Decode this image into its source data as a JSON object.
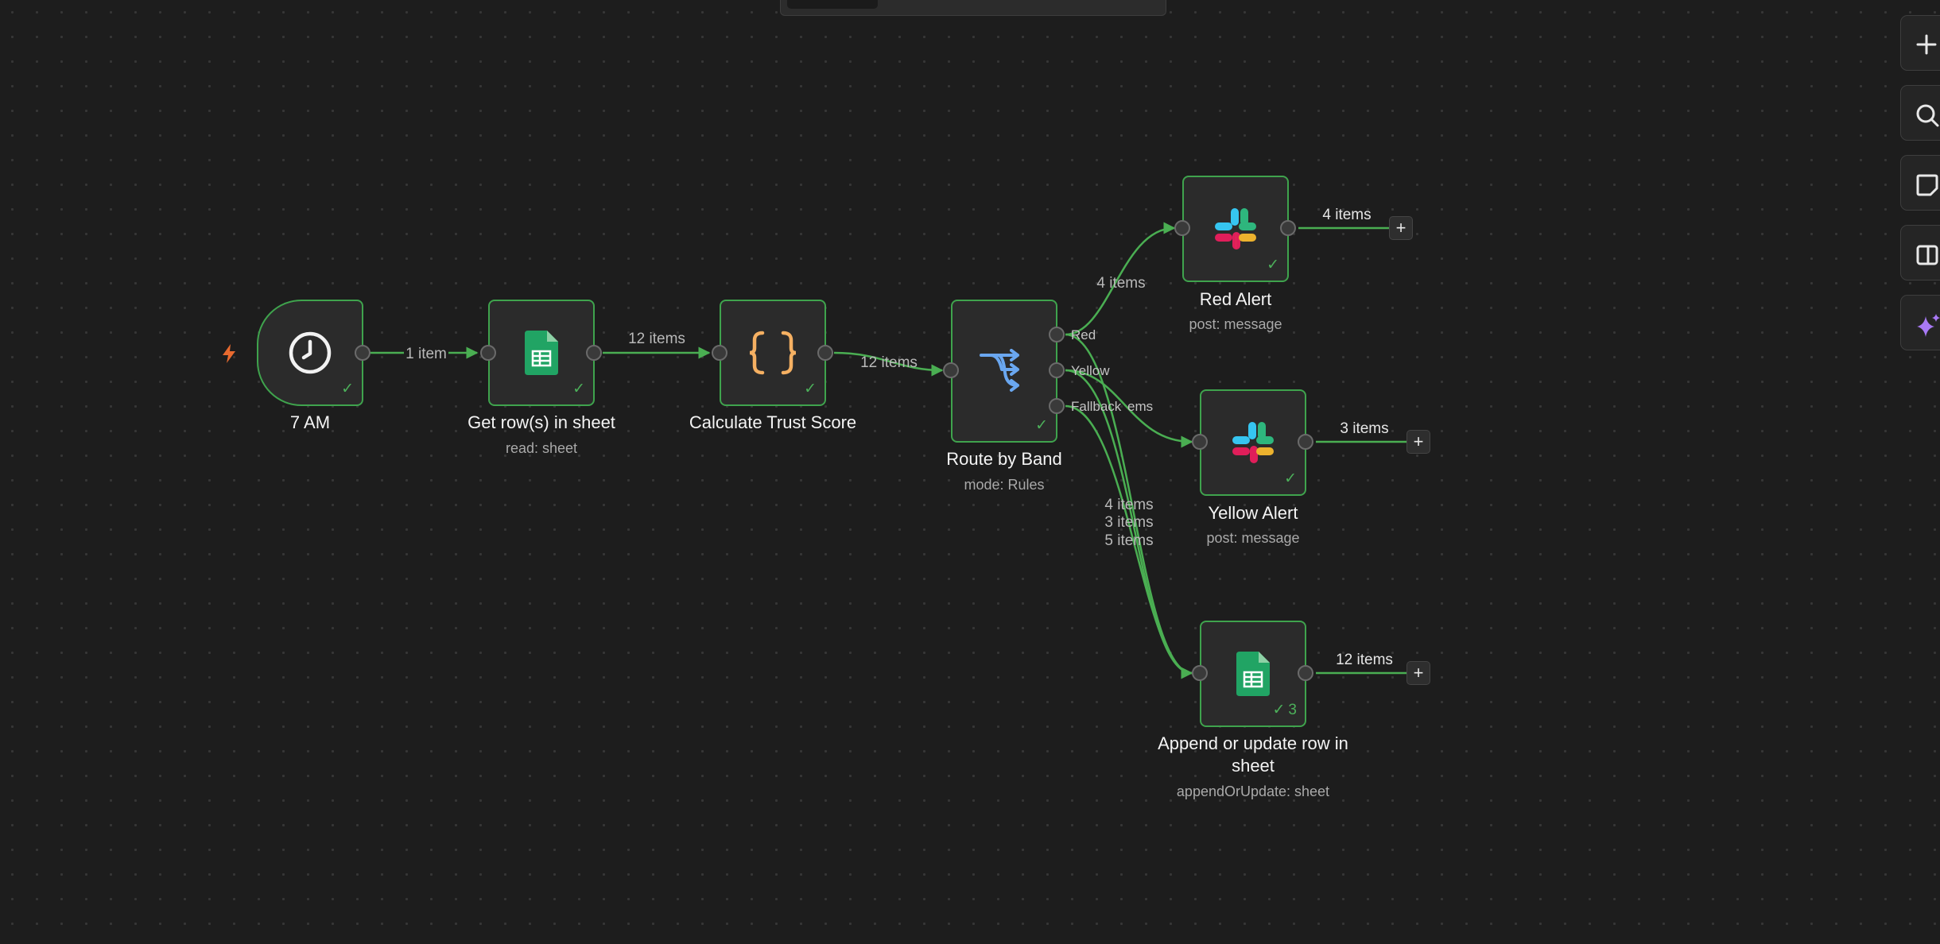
{
  "workflow": {
    "nodes": {
      "trigger": {
        "title": "7 AM",
        "icon": "clock-icon"
      },
      "get_rows": {
        "title": "Get row(s) in sheet",
        "subtitle": "read: sheet",
        "icon": "google-sheets-icon"
      },
      "calc": {
        "title": "Calculate Trust Score",
        "icon": "code-braces-icon"
      },
      "route": {
        "title": "Route by Band",
        "subtitle": "mode: Rules",
        "icon": "switch-route-icon"
      },
      "red_alert": {
        "title": "Red Alert",
        "subtitle": "post: message",
        "icon": "slack-icon"
      },
      "yellow_alert": {
        "title": "Yellow Alert",
        "subtitle": "post: message",
        "icon": "slack-icon"
      },
      "append": {
        "title_line1": "Append or update row in",
        "title_line2": "sheet",
        "subtitle": "appendOrUpdate: sheet",
        "icon": "google-sheets-icon",
        "run_count": "3"
      }
    },
    "edges": {
      "trigger_to_get": "1 item",
      "get_to_calc": "12 items",
      "calc_to_route": "12 items",
      "route_to_red": "4 items",
      "route_to_append_a": "4 items",
      "route_to_append_b": "3 items",
      "route_to_append_c": "5 items"
    },
    "route_outputs": {
      "red": "Red",
      "yellow": "Yellow",
      "fallback": "Fallback"
    },
    "trailing_outputs": {
      "red_alert": "4 items",
      "yellow_alert": "3 items",
      "append": "12 items"
    }
  },
  "sidebar": {
    "buttons": [
      "plus-icon",
      "search-icon",
      "sticky-note-icon",
      "panel-icon",
      "sparkle-icon"
    ],
    "add_label": "+"
  },
  "colors": {
    "success": "#3fa34d",
    "edge": "#4aae52",
    "canvas": "#1d1d1d",
    "node": "#2b2b2b",
    "trigger_bolt": "#e86a2f",
    "route_icon": "#6aa7f0",
    "code_icon": "#f5b062",
    "sheets": "#21a464",
    "ai_sparkle": "#a879f5"
  }
}
